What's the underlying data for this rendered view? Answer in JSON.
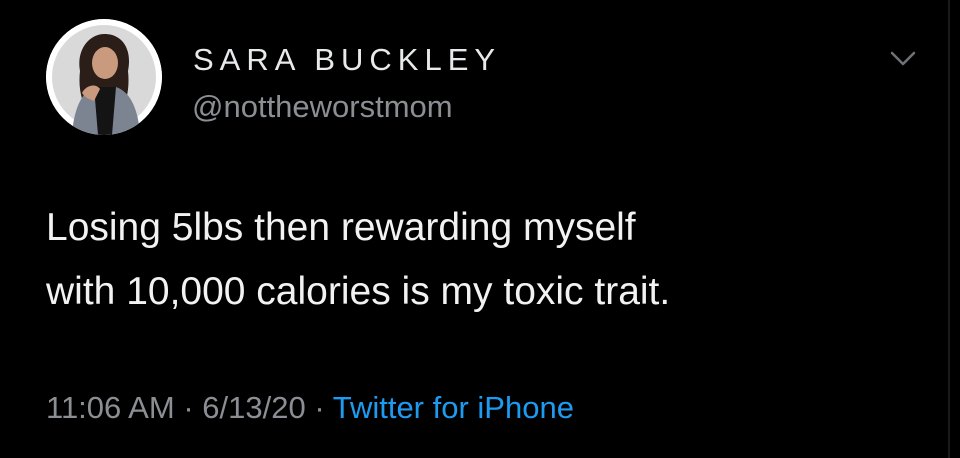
{
  "tweet": {
    "author": {
      "name": "SARA BUCKLEY",
      "handle": "@nottheworstmom"
    },
    "text_lines": [
      "Losing 5lbs then rewarding myself",
      "with 10,000 calories is my toxic trait."
    ],
    "time": "11:06 AM",
    "date": "6/13/20",
    "separator": "·",
    "source": "Twitter for iPhone",
    "menu_icon": "chevron-down-icon"
  },
  "colors": {
    "background": "#000000",
    "text": "#f2f2f2",
    "muted": "#8b8f94",
    "link": "#1d9bf0"
  }
}
